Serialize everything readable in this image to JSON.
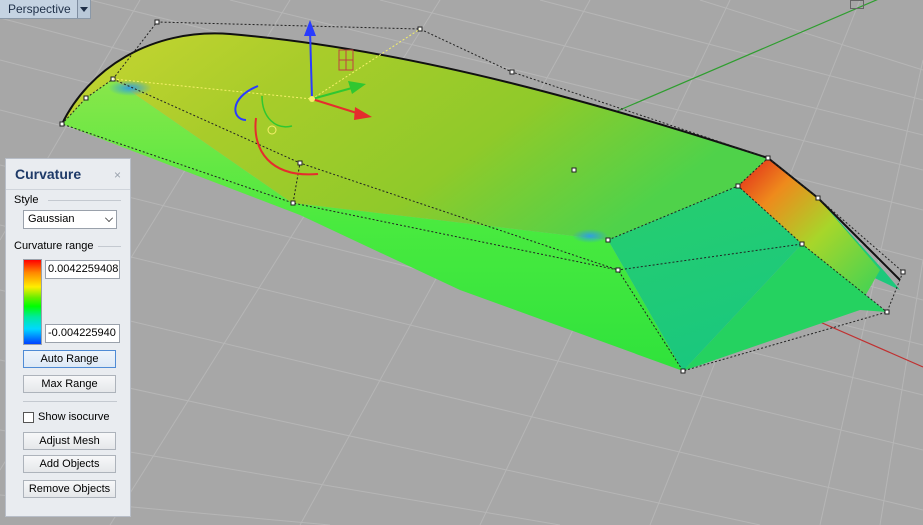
{
  "viewport": {
    "title": "Perspective",
    "title_dropdown_icon": "triangle-down-icon",
    "maximize_icon": "rectangle-icon",
    "background_color": "#a7a7a7",
    "grid_color": "#b6b6b6",
    "x_axis_color": "#c03030",
    "y_axis_color": "#2f9e2f"
  },
  "panel": {
    "title": "Curvature",
    "close_icon": "×",
    "style_label": "Style",
    "style_value": "Gaussian",
    "range_label": "Curvature range",
    "range_max": "0.0042259408",
    "range_min": "-0.004225940",
    "auto_range_label": "Auto Range",
    "max_range_label": "Max Range",
    "show_isocurve_label": "Show isocurve",
    "show_isocurve_checked": false,
    "adjust_mesh_label": "Adjust Mesh",
    "add_objects_label": "Add Objects",
    "remove_objects_label": "Remove Objects"
  }
}
